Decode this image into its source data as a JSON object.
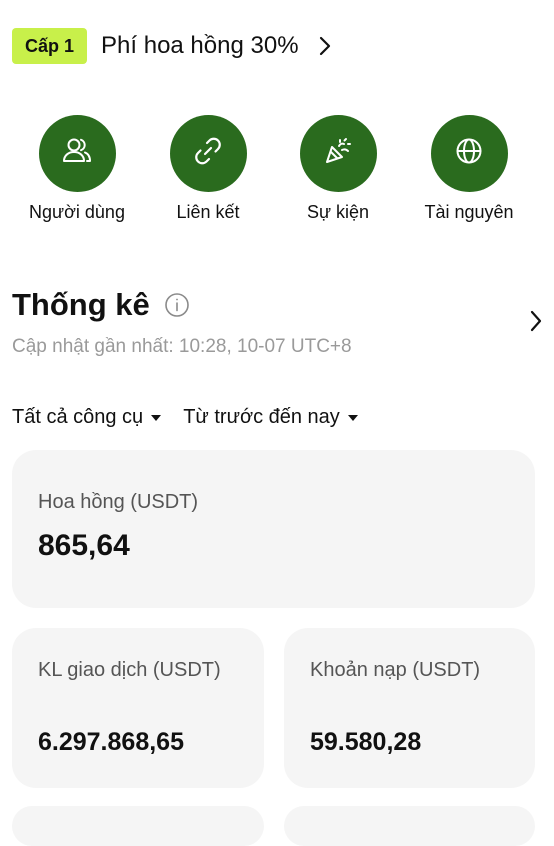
{
  "tier": {
    "badge": "Cấp 1",
    "commission_rate_text": "Phí hoa hồng 30%",
    "badge_color": "#c8f04a"
  },
  "quick_actions": [
    {
      "label": "Người dùng",
      "icon": "users-icon"
    },
    {
      "label": "Liên kết",
      "icon": "link-icon"
    },
    {
      "label": "Sự kiện",
      "icon": "party-popper-icon"
    },
    {
      "label": "Tài nguyên",
      "icon": "globe-icon"
    }
  ],
  "accent_color": "#2a6b1e",
  "stats": {
    "title": "Thống kê",
    "updated": "Cập nhật gần nhất: 10:28, 10-07 UTC+8"
  },
  "filters": {
    "instrument": "Tất cả công cụ",
    "period": "Từ trước đến nay"
  },
  "cards": {
    "commission": {
      "label": "Hoa hồng (USDT)",
      "value": "865,64"
    },
    "volume": {
      "label": "KL giao dịch (USDT)",
      "value": "6.297.868,65"
    },
    "deposit": {
      "label": "Khoản nạp (USDT)",
      "value": "59.580,28"
    }
  }
}
